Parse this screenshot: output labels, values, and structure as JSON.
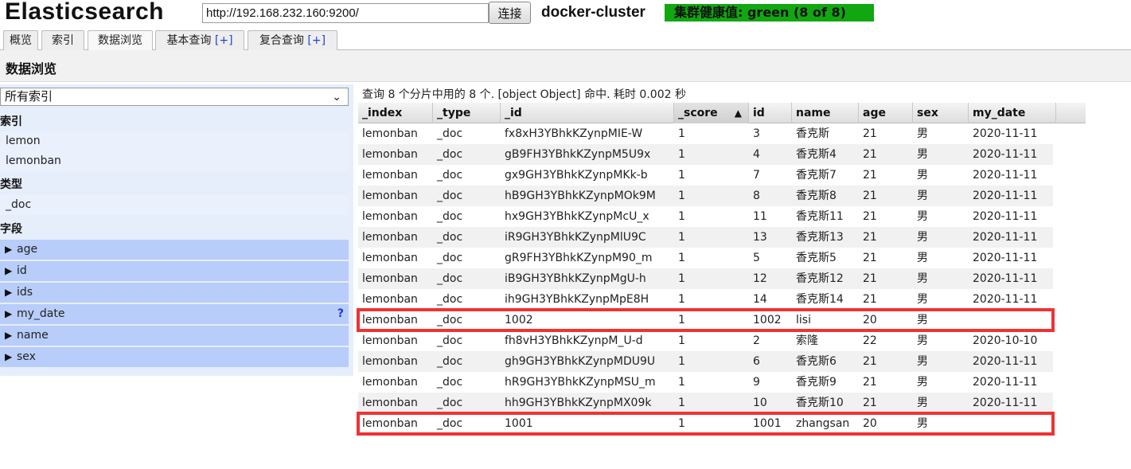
{
  "header": {
    "app_title": "Elasticsearch",
    "url": "http://192.168.232.160:9200/",
    "connect_label": "连接",
    "cluster_name": "docker-cluster",
    "health_text": "集群健康值: green (8 of 8)",
    "health_color": "#11a711"
  },
  "tabs": [
    {
      "label": "概览",
      "plus": ""
    },
    {
      "label": "索引",
      "plus": ""
    },
    {
      "label": "数据浏览",
      "plus": ""
    },
    {
      "label": "基本查询 ",
      "plus": "[+]"
    },
    {
      "label": "复合查询 ",
      "plus": "[+]"
    }
  ],
  "section_title": "数据浏览",
  "sidebar": {
    "index_select": "所有索引",
    "index_heading": "索引",
    "indices": [
      "lemon",
      "lemonban"
    ],
    "type_heading": "类型",
    "types": [
      "_doc"
    ],
    "field_heading": "字段",
    "fields": [
      "age",
      "id",
      "ids",
      "my_date",
      "name",
      "sex"
    ],
    "field_help": "?"
  },
  "results": {
    "summary": "查询 8 个分片中用的 8 个. [object Object] 命中. 耗时 0.002 秒",
    "columns": [
      "_index",
      "_type",
      "_id",
      "_score",
      "id",
      "name",
      "age",
      "sex",
      "my_date"
    ],
    "sort_arrow": "▲",
    "rows": [
      [
        "lemonban",
        "_doc",
        "fx8xH3YBhkKZynpMIE-W",
        "1",
        "3",
        "香克斯",
        "21",
        "男",
        "2020-11-11"
      ],
      [
        "lemonban",
        "_doc",
        "gB9FH3YBhkKZynpM5U9x",
        "1",
        "4",
        "香克斯4",
        "21",
        "男",
        "2020-11-11"
      ],
      [
        "lemonban",
        "_doc",
        "gx9GH3YBhkKZynpMKk-b",
        "1",
        "7",
        "香克斯7",
        "21",
        "男",
        "2020-11-11"
      ],
      [
        "lemonban",
        "_doc",
        "hB9GH3YBhkKZynpMOk9M",
        "1",
        "8",
        "香克斯8",
        "21",
        "男",
        "2020-11-11"
      ],
      [
        "lemonban",
        "_doc",
        "hx9GH3YBhkKZynpMcU_x",
        "1",
        "11",
        "香克斯11",
        "21",
        "男",
        "2020-11-11"
      ],
      [
        "lemonban",
        "_doc",
        "iR9GH3YBhkKZynpMlU9C",
        "1",
        "13",
        "香克斯13",
        "21",
        "男",
        "2020-11-11"
      ],
      [
        "lemonban",
        "_doc",
        "gR9FH3YBhkKZynpM90_m",
        "1",
        "5",
        "香克斯5",
        "21",
        "男",
        "2020-11-11"
      ],
      [
        "lemonban",
        "_doc",
        "iB9GH3YBhkKZynpMgU-h",
        "1",
        "12",
        "香克斯12",
        "21",
        "男",
        "2020-11-11"
      ],
      [
        "lemonban",
        "_doc",
        "ih9GH3YBhkKZynpMpE8H",
        "1",
        "14",
        "香克斯14",
        "21",
        "男",
        "2020-11-11"
      ],
      [
        "lemonban",
        "_doc",
        "1002",
        "1",
        "1002",
        "lisi",
        "20",
        "男",
        ""
      ],
      [
        "lemonban",
        "_doc",
        "fh8vH3YBhkKZynpM_U-d",
        "1",
        "2",
        "索隆",
        "22",
        "男",
        "2020-10-10"
      ],
      [
        "lemonban",
        "_doc",
        "gh9GH3YBhkKZynpMDU9U",
        "1",
        "6",
        "香克斯6",
        "21",
        "男",
        "2020-11-11"
      ],
      [
        "lemonban",
        "_doc",
        "hR9GH3YBhkKZynpMSU_m",
        "1",
        "9",
        "香克斯9",
        "21",
        "男",
        "2020-11-11"
      ],
      [
        "lemonban",
        "_doc",
        "hh9GH3YBhkKZynpMX09k",
        "1",
        "10",
        "香克斯10",
        "21",
        "男",
        "2020-11-11"
      ],
      [
        "lemonban",
        "_doc",
        "1001",
        "1",
        "1001",
        "zhangsan",
        "20",
        "男",
        ""
      ]
    ],
    "highlighted_rows": [
      9,
      14
    ],
    "highlight_color": "#ee3333"
  }
}
